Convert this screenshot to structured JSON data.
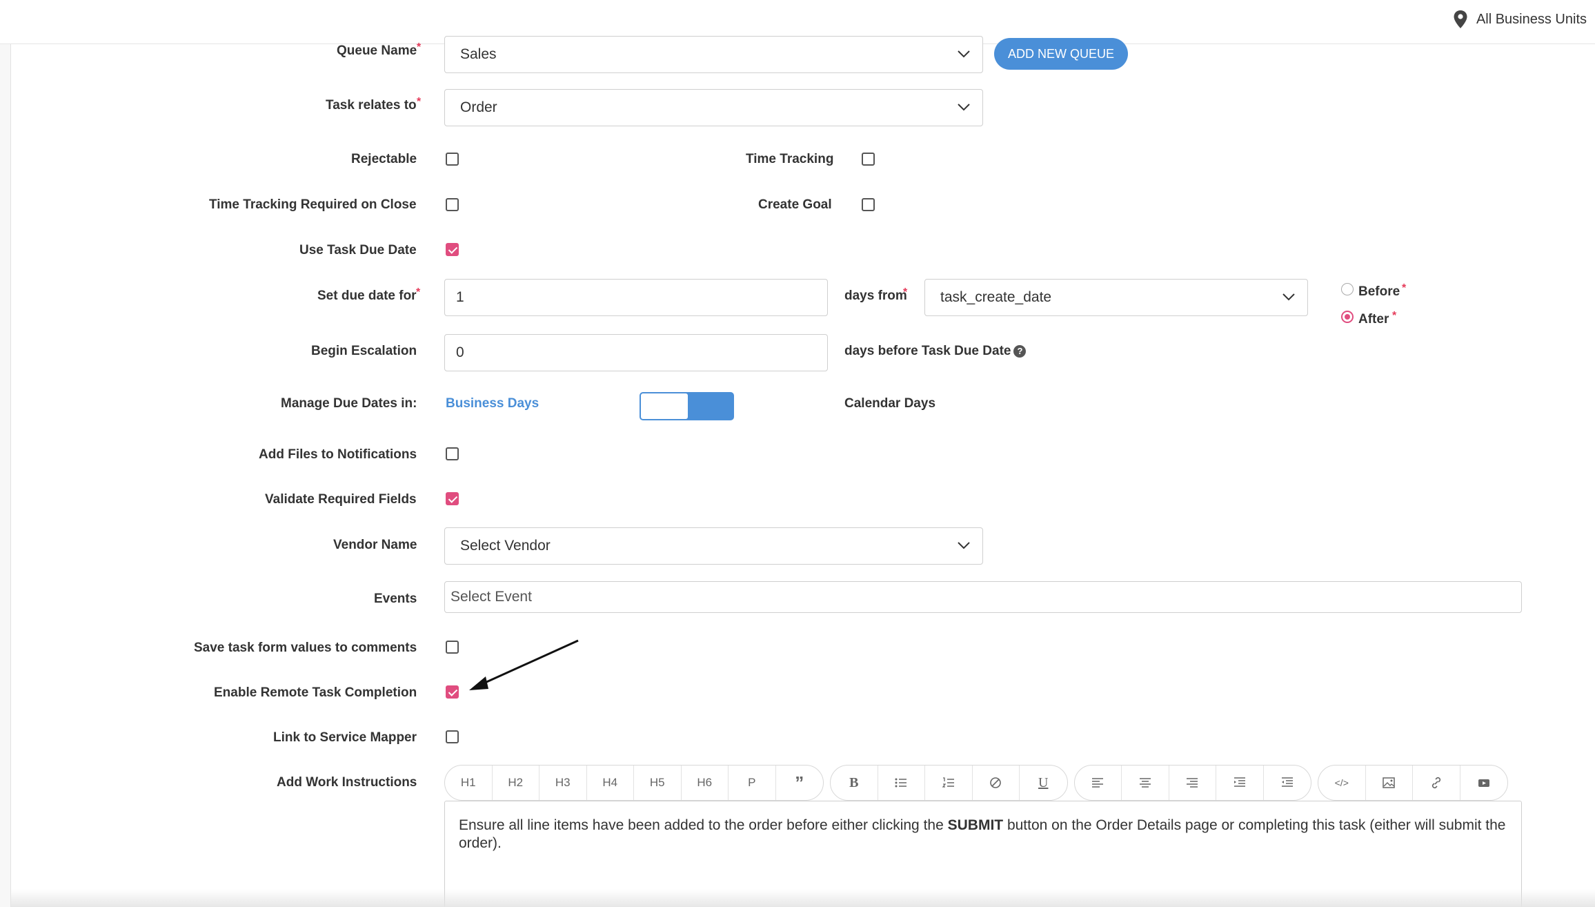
{
  "header": {
    "business_units": "All Business Units",
    "location_icon": "map-pin-icon"
  },
  "form": {
    "queue_name": {
      "label": "Queue Name",
      "value": "Sales",
      "add_button": "ADD NEW QUEUE"
    },
    "task_relates_to": {
      "label": "Task relates to",
      "value": "Order"
    },
    "rejectable": {
      "label": "Rejectable",
      "checked": false
    },
    "time_tracking": {
      "label": "Time Tracking",
      "checked": false
    },
    "time_tracking_required": {
      "label": "Time Tracking Required on Close",
      "checked": false
    },
    "create_goal": {
      "label": "Create Goal",
      "checked": false
    },
    "use_task_due_date": {
      "label": "Use Task Due Date",
      "checked": true
    },
    "set_due_date": {
      "label": "Set due date for",
      "value": "1",
      "days_from_label": "days from",
      "days_from_value": "task_create_date",
      "before_label": "Before",
      "after_label": "After",
      "selected": "After"
    },
    "begin_escalation": {
      "label": "Begin Escalation",
      "value": "0",
      "suffix": "days before Task Due Date",
      "help": "?"
    },
    "manage_due_dates": {
      "label": "Manage Due Dates in:",
      "left_option": "Business Days",
      "right_option": "Calendar Days",
      "selected": "Calendar Days"
    },
    "add_files": {
      "label": "Add Files to Notifications",
      "checked": false
    },
    "validate_required": {
      "label": "Validate Required Fields",
      "checked": true
    },
    "vendor_name": {
      "label": "Vendor Name",
      "value": "Select Vendor"
    },
    "events": {
      "label": "Events",
      "placeholder": "Select Event"
    },
    "save_task_form": {
      "label": "Save task form values to comments",
      "checked": false
    },
    "enable_remote": {
      "label": "Enable Remote Task Completion",
      "checked": true
    },
    "link_service_mapper": {
      "label": "Link to Service Mapper",
      "checked": false
    },
    "work_instructions": {
      "label": "Add Work Instructions",
      "toolbar": {
        "headings": [
          "H1",
          "H2",
          "H3",
          "H4",
          "H5",
          "H6",
          "P"
        ],
        "quote_icon": "blockquote-icon",
        "bold": "B",
        "underline": "U"
      },
      "text_before": "Ensure all line items have been added to the order before either clicking the ",
      "text_bold": "SUBMIT",
      "text_after": " button on the Order Details page or completing this task (either will submit the order)."
    }
  },
  "colors": {
    "accent": "#4a8fd8",
    "checkbox": "#e04d7f",
    "required": "#e53b5a"
  }
}
